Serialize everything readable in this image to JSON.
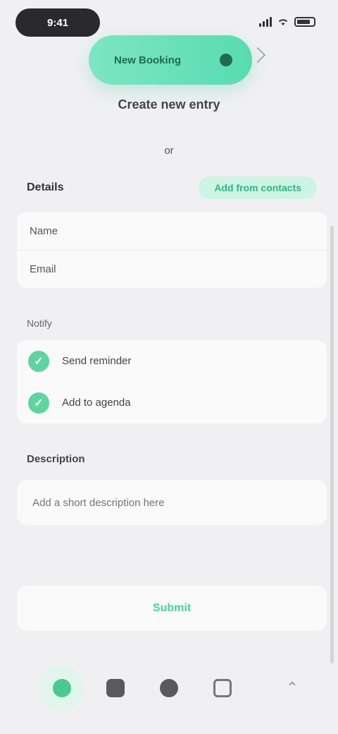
{
  "status_bar": {
    "time": "9:41"
  },
  "hero": {
    "label": "New Booking",
    "dot_icon": "circle-icon",
    "side_icon": "chevron-right-icon"
  },
  "subtitle": "Create new entry",
  "small_label": "or",
  "section": {
    "title": "Details",
    "action_label": "Add from contacts"
  },
  "fields": [
    {
      "label": "Name"
    },
    {
      "label": "Email"
    }
  ],
  "options_group_label": "Notify",
  "options": [
    {
      "label": "Send reminder",
      "checked": true
    },
    {
      "label": "Add to agenda",
      "checked": true
    }
  ],
  "note": {
    "label": "Description",
    "placeholder": "Add a short description here"
  },
  "submit_label": "Submit",
  "tabs": [
    {
      "icon": "home-icon",
      "active": true
    },
    {
      "icon": "bag-icon",
      "active": false
    },
    {
      "icon": "chat-icon",
      "active": false
    },
    {
      "icon": "calendar-icon",
      "active": false
    }
  ],
  "more_icon": "chevron-up-icon",
  "colors": {
    "accent": "#49c990",
    "accent_soft": "#cdf4e4",
    "background": "#f0f0f3"
  }
}
